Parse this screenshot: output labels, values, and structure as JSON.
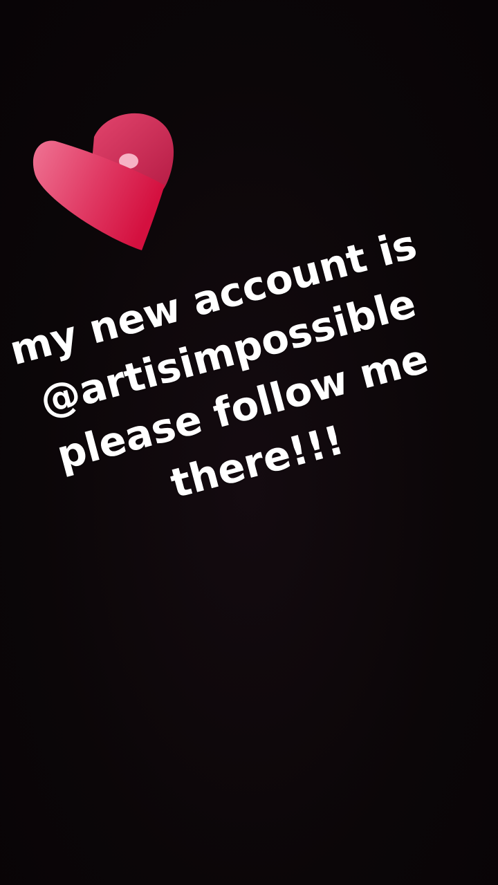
{
  "sticker": {
    "icon": "heart-icon",
    "colors": {
      "front_light": "#ee6b8d",
      "front_dark": "#d8184a",
      "back": "#c0224c",
      "highlight": "#f4a7bd"
    }
  },
  "caption": {
    "lines": [
      "my new account is",
      "@artisimpossible",
      "please follow me",
      "there!!!"
    ],
    "color": "#ffffff"
  }
}
